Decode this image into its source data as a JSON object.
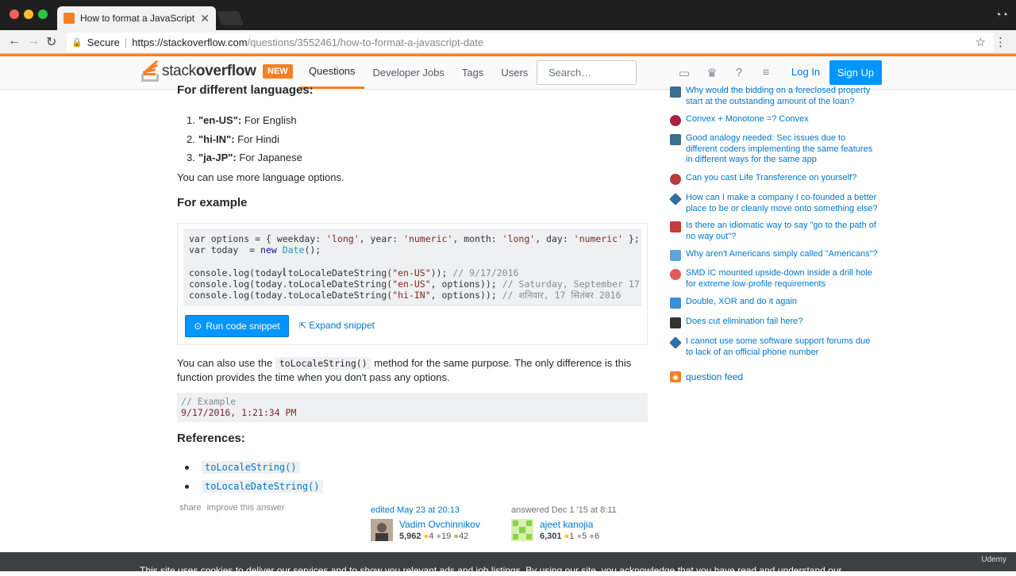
{
  "browser": {
    "tab_title": "How to format a JavaScript date",
    "secure_label": "Secure",
    "url_host": "https://stackoverflow.com",
    "url_path": "/questions/3552461/how-to-format-a-javascript-date"
  },
  "topbar": {
    "logo_light": "stack",
    "logo_bold": "overflow",
    "new_badge": "NEW",
    "nav": [
      "Questions",
      "Developer Jobs",
      "Tags",
      "Users"
    ],
    "search_placeholder": "Search…",
    "login": "Log In",
    "signup": "Sign Up"
  },
  "answer": {
    "heading_languages": "For different languages:",
    "languages": [
      {
        "num": "1.",
        "code": "\"en-US\":",
        "text": " For English"
      },
      {
        "num": "2.",
        "code": "\"hi-IN\":",
        "text": " For Hindi"
      },
      {
        "num": "3.",
        "code": "\"ja-JP\":",
        "text": " For Japanese"
      }
    ],
    "more_options": "You can use more language options.",
    "heading_example": "For example",
    "run_button": "Run code snippet",
    "expand_link": "Expand snippet",
    "p2_before": "You can also use the ",
    "p2_code": "toLocaleString()",
    "p2_after": " method for the same purpose. The only difference is this function provides the time when you don't pass any options.",
    "example_comment": "// Example",
    "example_value": "9/17/2016, 1:21:34 PM",
    "heading_refs": "References:",
    "refs": [
      "toLocaleString()",
      "toLocaleDateString()"
    ],
    "share": "share",
    "improve": "improve this answer"
  },
  "editor": {
    "action": "edited May 23 at 20:13",
    "name": "Vadim Ovchinnikov",
    "rep": "5,962",
    "gold": "4",
    "silver": "19",
    "bronze": "42"
  },
  "author": {
    "action": "answered Dec 1 '15 at 8:11",
    "name": "ajeet kanojia",
    "rep": "6,301",
    "gold": "1",
    "silver": "5",
    "bronze": "6"
  },
  "hot_questions": [
    {
      "title": "Why would the bidding on a foreclosed property start at the outstanding amount of the loan?",
      "color": "#3c6e8f"
    },
    {
      "title": "Convex + Monotone =? Convex",
      "color": "#a8213d"
    },
    {
      "title": "Good analogy needed: Sec issues due to different coders implementing the same features in different ways for the same app",
      "color": "#3c6e8f"
    },
    {
      "title": "Can you cast Life Transference on yourself?",
      "color": "#b83a3a"
    },
    {
      "title": "How can I make a company I co-founded a better place to be or cleanly move onto something else?",
      "color": "#2f6fa3"
    },
    {
      "title": "Is there an idiomatic way to say \"go to the path of no way out\"?",
      "color": "#c83a3a"
    },
    {
      "title": "Why aren't Americans simply called \"Americans\"?",
      "color": "#5fa3d9"
    },
    {
      "title": "SMD IC mounted upside-down inside a drill hole for extreme low-profile requirements",
      "color": "#e05a5a"
    },
    {
      "title": "Double, XOR and do it again",
      "color": "#3b8fd9"
    },
    {
      "title": "Does cut elimination fail here?",
      "color": "#333333"
    },
    {
      "title": "I cannot use some software support forums due to lack of an official phone number",
      "color": "#2f6fa3"
    }
  ],
  "question_feed": "question feed",
  "cookie_text": "This site uses cookies to deliver our services and to show you relevant ads and job listings. By using our site, you acknowledge that you have read and understand our",
  "watermark": "Udemy",
  "colors": {
    "accent": "#f48024",
    "link": "#0077cc",
    "button": "#0095ff"
  }
}
